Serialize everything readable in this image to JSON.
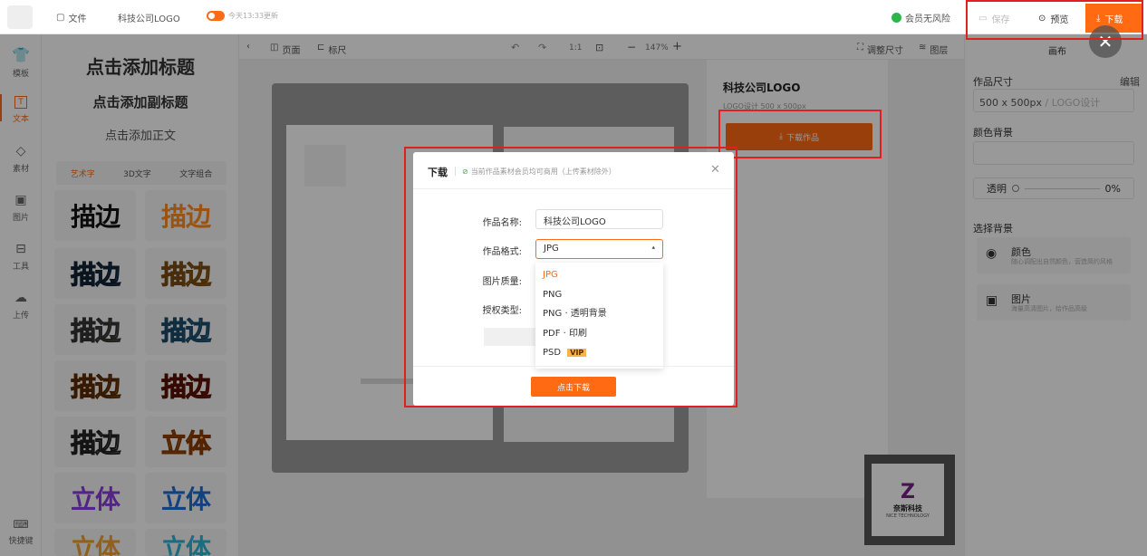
{
  "topbar": {
    "file_label": "文件",
    "doc_title": "科技公司LOGO",
    "update_note": "今天13:33更新",
    "risk_label": "会员无风险",
    "save_label": "保存",
    "preview_label": "预览",
    "download_label": "下载"
  },
  "rail": {
    "items": [
      {
        "label": "模板",
        "icon": "shirt-icon"
      },
      {
        "label": "文本",
        "icon": "text-icon"
      },
      {
        "label": "素材",
        "icon": "shapes-icon"
      },
      {
        "label": "图片",
        "icon": "image-icon"
      },
      {
        "label": "工具",
        "icon": "toolbox-icon"
      },
      {
        "label": "上传",
        "icon": "upload-icon"
      }
    ],
    "shortcut_label": "快捷键"
  },
  "panel": {
    "title": "点击添加标题",
    "subtitle": "点击添加副标题",
    "body": "点击添加正文",
    "tabs": [
      "艺术字",
      "3D文字",
      "文字组合"
    ],
    "tiles": [
      "描边",
      "描边",
      "描边",
      "描边",
      "描边",
      "描边",
      "描边",
      "描边",
      "描边",
      "立体",
      "立体",
      "立体",
      "立体",
      "立体"
    ]
  },
  "canvasbar": {
    "page_label": "页面",
    "ruler_label": "标尺",
    "ratio_label": "1:1",
    "zoom": "147%",
    "resize_label": "调整尺寸",
    "layers_label": "图层"
  },
  "right": {
    "canvas_title": "画布",
    "size_label": "作品尺寸",
    "edit_label": "编辑",
    "size_value": "500 x 500px",
    "size_hint": "/ LOGO设计",
    "bg_color_label": "颜色背景",
    "opacity_label": "透明",
    "opacity_value": "0%",
    "bg_select_label": "选择背景",
    "color_title": "颜色",
    "color_desc": "随心调配出自然颜色，营造简约风格",
    "image_title": "图片",
    "image_desc": "海量高清图片，给作品高级"
  },
  "popover": {
    "title": "科技公司LOGO",
    "subtitle": "LOGO设计 500 x 500px",
    "download_label": "下载作品"
  },
  "logo_text": "奈斯科技",
  "logo_sub": "NICE TECHNOLOGY",
  "modal": {
    "title": "下载",
    "notice": "当前作品素材会员均可商用（上传素材除外）",
    "name_label": "作品名称:",
    "name_value": "科技公司LOGO",
    "format_label": "作品格式:",
    "format_value": "JPG",
    "quality_label": "图片质量:",
    "license_label": "授权类型:",
    "submit_label": "点击下载",
    "options": [
      "JPG",
      "PNG",
      "PNG · 透明背景",
      "PDF · 印刷",
      "PSD"
    ],
    "vip_badge": "VIP"
  },
  "colors": {
    "accent": "#ff6a13",
    "highlight": "#e02020"
  }
}
